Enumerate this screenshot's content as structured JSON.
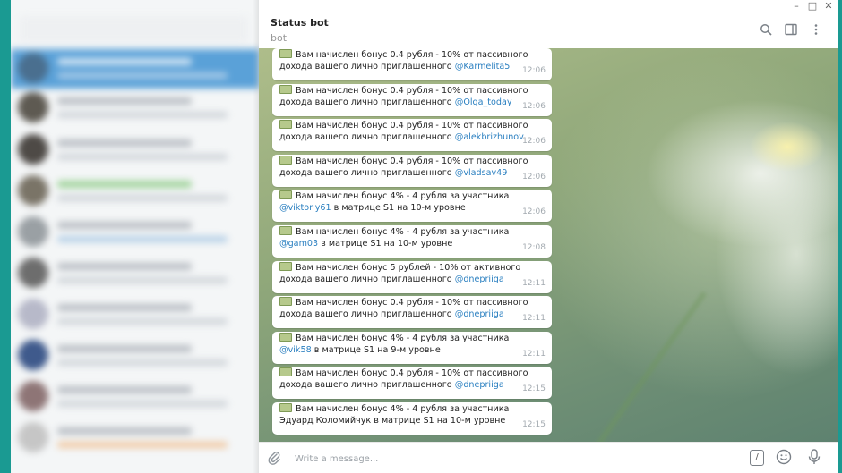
{
  "window": {
    "min_glyph": "–",
    "max_glyph": "□",
    "close_glyph": "✕"
  },
  "chat": {
    "title": "Status bot",
    "subtitle": "bot",
    "messages": [
      {
        "pre": "Вам начислен бонус 0.4 рубля - 10% от пассивного дохода вашего лично приглашенного ",
        "mention": "@Karmelita5",
        "post": "",
        "time": "12:06"
      },
      {
        "pre": "Вам начислен бонус 0.4 рубля - 10% от пассивного дохода вашего лично приглашенного ",
        "mention": "@Olga_today",
        "post": "",
        "time": "12:06"
      },
      {
        "pre": "Вам начислен бонус 0.4 рубля - 10% от пассивного дохода вашего лично приглашенного ",
        "mention": "@alekbrizhunov",
        "post": "",
        "time": "12:06"
      },
      {
        "pre": "Вам начислен бонус 0.4 рубля - 10% от пассивного дохода вашего лично приглашенного ",
        "mention": "@vladsav49",
        "post": "",
        "time": "12:06"
      },
      {
        "pre": "Вам начислен бонус 4% - 4 рубля за участника ",
        "mention": "@viktoriy61",
        "post": " в матрице S1 на 10-м уровне",
        "time": "12:06"
      },
      {
        "pre": "Вам начислен бонус 4% - 4 рубля за участника ",
        "mention": "@gam03",
        "post": " в матрице S1 на 10-м уровне",
        "time": "12:08"
      },
      {
        "pre": "Вам начислен бонус 5 рублей - 10% от активного дохода вашего лично приглашенного ",
        "mention": "@dnepriiga",
        "post": "",
        "time": "12:11"
      },
      {
        "pre": "Вам начислен бонус 0.4 рубля - 10% от пассивного дохода вашего лично приглашенного ",
        "mention": "@dnepriiga",
        "post": "",
        "time": "12:11"
      },
      {
        "pre": "Вам начислен бонус 4% - 4 рубля за участника ",
        "mention": "@vik58",
        "post": " в матрице S1 на 9-м уровне",
        "time": "12:11"
      },
      {
        "pre": "Вам начислен бонус 0.4 рубля - 10% от пассивного дохода вашего лично приглашенного ",
        "mention": "@dnepriiga",
        "post": "",
        "time": "12:15"
      },
      {
        "pre": "Вам начислен бонус 4% - 4 рубля за участника Эдуард Коломийчук в матрице S1 на 10-м уровне",
        "mention": "",
        "post": "",
        "time": "12:15"
      }
    ]
  },
  "composer": {
    "placeholder": "Write a message...",
    "command_glyph": "/"
  },
  "icons": {
    "search": "search-icon",
    "side_panel": "side-panel-icon",
    "more": "more-vert-icon",
    "attach": "paperclip-icon",
    "commands": "bot-commands-icon",
    "emoji": "emoji-icon",
    "mic": "microphone-icon",
    "message_emoji": "money-bag-emoji-icon"
  },
  "colors": {
    "accent": "#2a7fc0",
    "selected_chat": "#5aa1d8",
    "window_frame": "#1a9a92"
  }
}
